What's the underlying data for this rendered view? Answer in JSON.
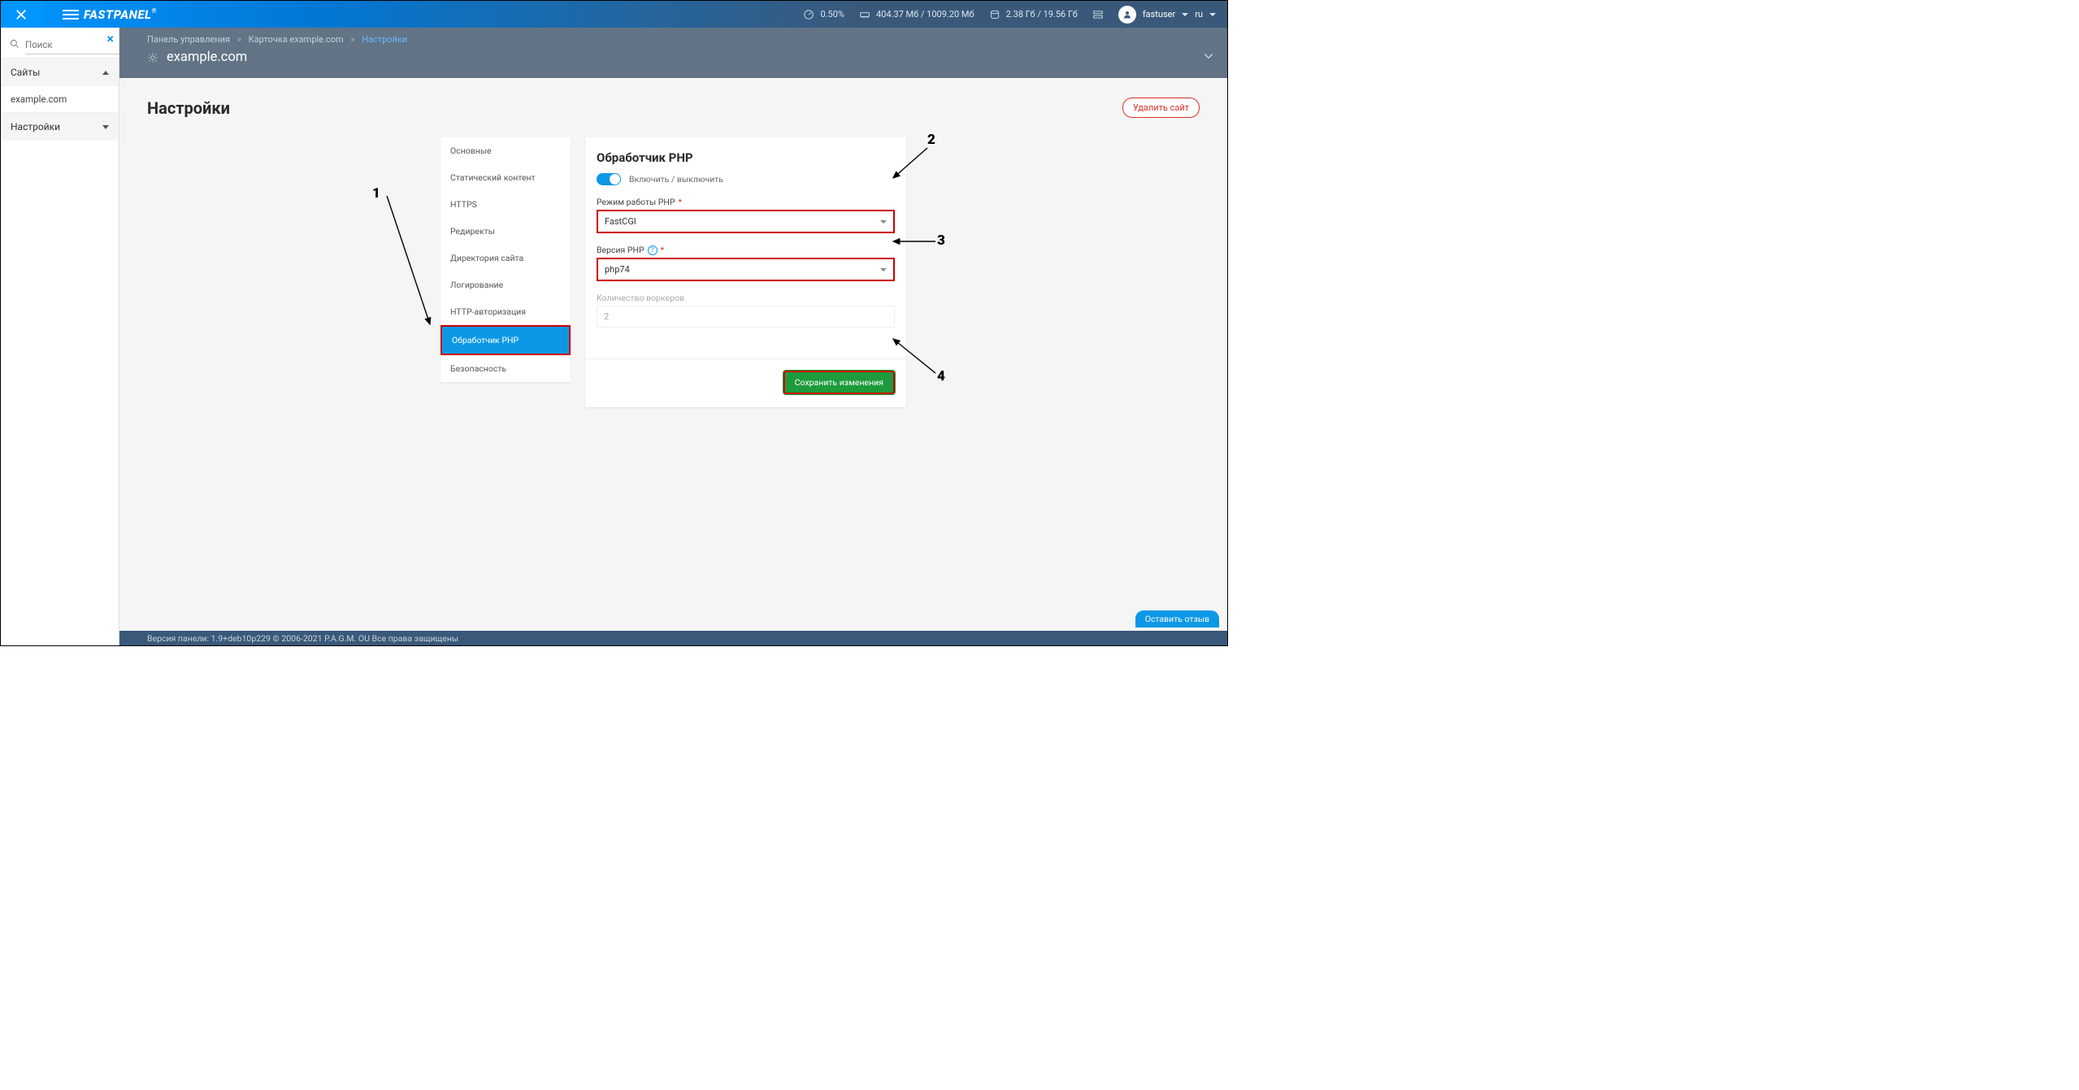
{
  "topbar": {
    "brand": "FASTPANEL",
    "cpu": "0.50%",
    "mem": "404.37 Мб / 1009.20 Мб",
    "disk": "2.38 Гб / 19.56 Гб",
    "user": "fastuser",
    "lang": "ru"
  },
  "sidebar": {
    "search_placeholder": "Поиск",
    "sites_label": "Сайты",
    "site_item": "example.com",
    "settings_label": "Настройки"
  },
  "breadcrumb": {
    "a": "Панель управления",
    "b": "Карточка example.com",
    "c": "Настройки"
  },
  "subheader": {
    "site": "example.com"
  },
  "page": {
    "title": "Настройки",
    "delete_btn": "Удалить сайт"
  },
  "tabs": {
    "t0": "Основные",
    "t1": "Статический контент",
    "t2": "HTTPS",
    "t3": "Редиректы",
    "t4": "Директория сайта",
    "t5": "Логирование",
    "t6": "HTTP-авторизация",
    "t7": "Обработчик PHP",
    "t8": "Безопасность"
  },
  "form": {
    "title": "Обработчик PHP",
    "toggle_label": "Включить / выключить",
    "mode_label": "Режим работы PHP",
    "mode_value": "FastCGI",
    "version_label": "Версия PHP",
    "version_value": "php74",
    "workers_label": "Количество воркеров",
    "workers_value": "2",
    "save_btn": "Сохранить изменения"
  },
  "annotations": {
    "n1": "1",
    "n2": "2",
    "n3": "3",
    "n4": "4"
  },
  "footer": {
    "text": "Версия панели: 1.9+deb10p229 © 2006-2021 P.A.G.M. OU Все права защищены",
    "feedback": "Оставить отзыв"
  }
}
